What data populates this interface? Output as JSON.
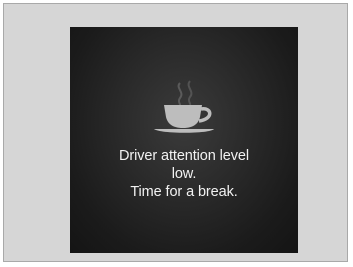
{
  "display": {
    "icon": "coffee-cup-icon",
    "message_lines": [
      "Driver attention level",
      "low.",
      "Time for a break."
    ]
  }
}
